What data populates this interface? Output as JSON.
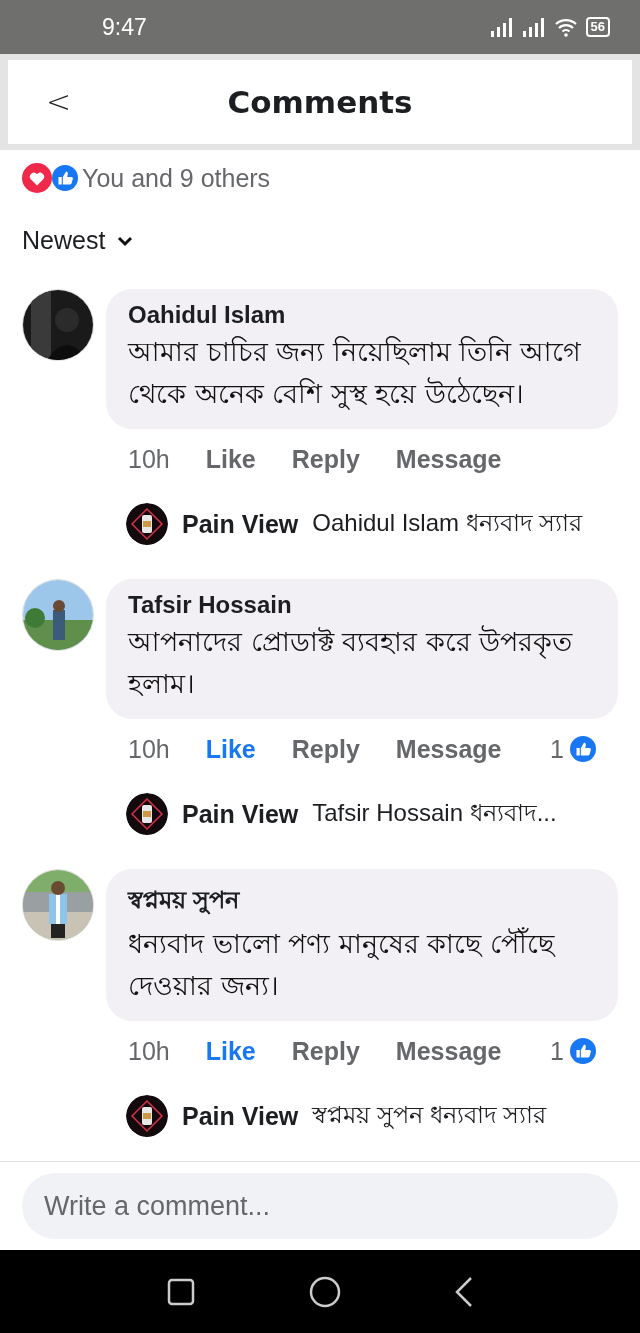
{
  "status_bar": {
    "time": "9:47",
    "battery": "56"
  },
  "header": {
    "back": "<",
    "title": "Comments"
  },
  "reactions": {
    "text": "You and 9 others"
  },
  "sort": {
    "label": "Newest"
  },
  "comments": [
    {
      "name": "Oahidul Islam",
      "text": "আমার চাচির জন্য নিয়েছিলাম তিনি আগে থেকে অনেক বেশি সুস্থ হয়ে উঠেছেন।",
      "time": "10h",
      "like": {
        "label": "Like",
        "selected": false
      },
      "reply": "Reply",
      "message": "Message",
      "reply_preview": {
        "page": "Pain View",
        "text": "Oahidul Islam ধন্যবাদ স্যার"
      }
    },
    {
      "name": "Tafsir Hossain",
      "text": "আপনাদের প্রোডাক্ট ব্যবহার করে উপরকৃত হলাম।",
      "time": "10h",
      "like": {
        "label": "Like",
        "selected": true
      },
      "reply": "Reply",
      "message": "Message",
      "like_count": "1",
      "reply_preview": {
        "page": "Pain View",
        "text": "Tafsir Hossain ধন্যবাদ..."
      }
    },
    {
      "name": "স্বপ্নময় সুপন",
      "text": "ধন্যবাদ ভালো পণ্য মানুষের কাছে পৌঁছে দেওয়ার জন্য।",
      "time": "10h",
      "like": {
        "label": "Like",
        "selected": true
      },
      "reply": "Reply",
      "message": "Message",
      "like_count": "1",
      "reply_preview": {
        "page": "Pain View",
        "text": "স্বপ্নময় সুপন ধন্যবাদ স্যার"
      }
    }
  ],
  "composer": {
    "placeholder": "Write a comment..."
  }
}
